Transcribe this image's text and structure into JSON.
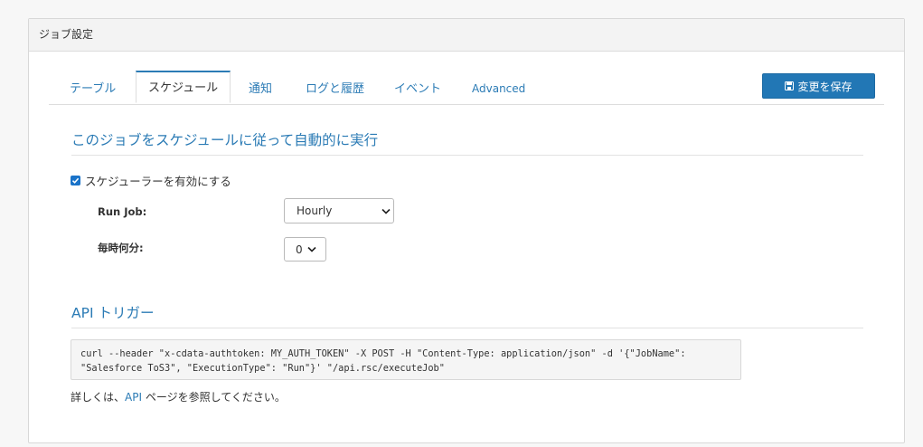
{
  "panel": {
    "title": "ジョブ設定"
  },
  "tabs": [
    {
      "label": "テーブル"
    },
    {
      "label": "スケジュール"
    },
    {
      "label": "通知"
    },
    {
      "label": "ログと履歴"
    },
    {
      "label": "イベント"
    },
    {
      "label": "Advanced"
    }
  ],
  "active_tab": "スケジュール",
  "save_button": {
    "label": "変更を保存",
    "icon": "save-icon"
  },
  "schedule": {
    "title": "このジョブをスケジュールに従って自動的に実行",
    "enable_checkbox": {
      "label": "スケジューラーを有効にする",
      "checked": true
    },
    "run_job": {
      "label": "Run Job:",
      "value": "Hourly"
    },
    "minute": {
      "label": "毎時何分:",
      "value": "0"
    }
  },
  "api": {
    "title": "API トリガー",
    "code": "curl --header \"x-cdata-authtoken: MY_AUTH_TOKEN\" -X POST -H \"Content-Type: application/json\" -d '{\"JobName\": \"Salesforce ToS3\", \"ExecutionType\": \"Run\"}' \"/api.rsc/executeJob\"",
    "help_prefix": "詳しくは、",
    "help_link": "API",
    "help_suffix": " ページを参照してください。"
  },
  "colors": {
    "accent": "#2b7bb5",
    "button": "#2277b5"
  }
}
